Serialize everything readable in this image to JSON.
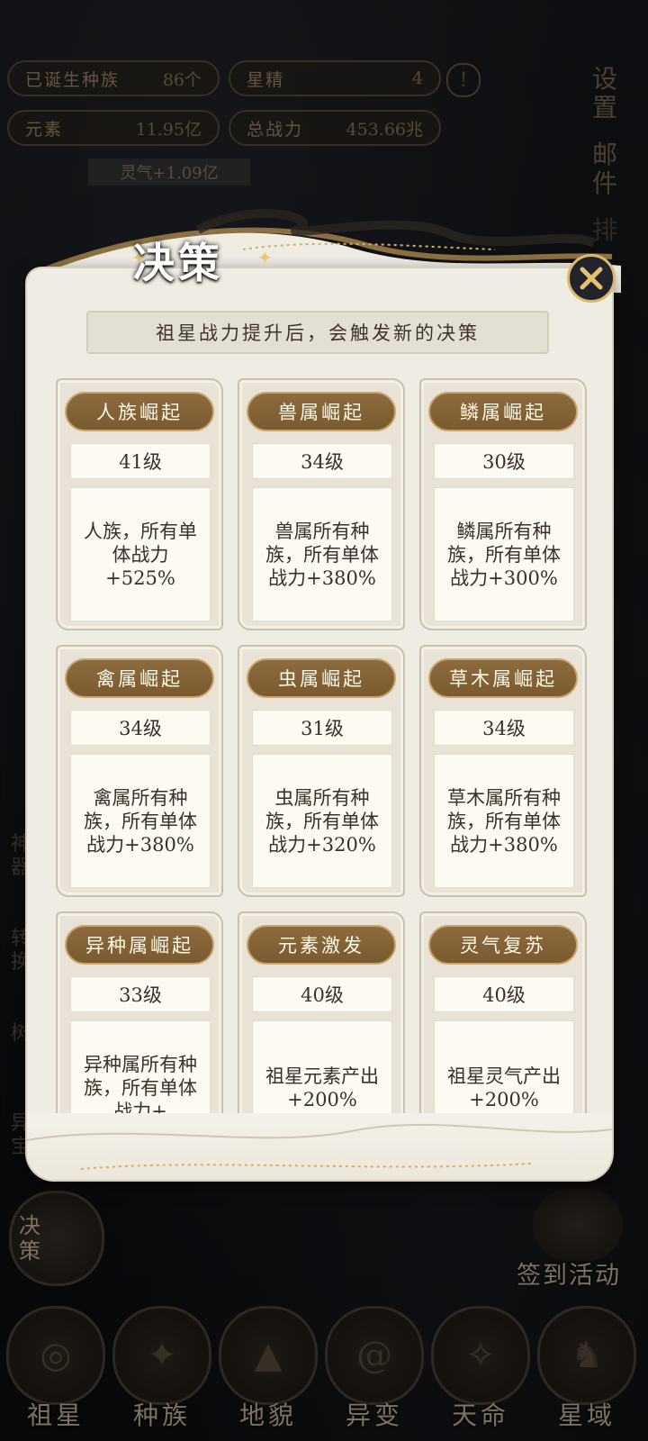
{
  "stats": {
    "races_label": "已诞生种族",
    "races_value": "86个",
    "essence_label": "星精",
    "essence_value": "4",
    "element_label": "元素",
    "element_value": "11.95亿",
    "power_label": "总战力",
    "power_value": "453.66兆",
    "aura_gain": "灵气+1.09亿"
  },
  "side_menu": {
    "settings": "设置",
    "mail": "邮件",
    "rank": "排"
  },
  "left_rail": {
    "r1": "神器",
    "r2": "转换",
    "r3": "树",
    "r4": "异宝"
  },
  "decision_button": "决策",
  "activity_button": "签到活动",
  "bottom_nav": [
    "祖星",
    "种族",
    "地貌",
    "异变",
    "天命",
    "星域"
  ],
  "modal": {
    "title": "决策",
    "hint": "祖星战力提升后，会触发新的决策",
    "cards": [
      {
        "name": "人族崛起",
        "level": "41级",
        "desc": "人族，所有单体战力+525%"
      },
      {
        "name": "兽属崛起",
        "level": "34级",
        "desc": "兽属所有种族，所有单体战力+380%"
      },
      {
        "name": "鳞属崛起",
        "level": "30级",
        "desc": "鳞属所有种族，所有单体战力+300%"
      },
      {
        "name": "禽属崛起",
        "level": "34级",
        "desc": "禽属所有种族，所有单体战力+380%"
      },
      {
        "name": "虫属崛起",
        "level": "31级",
        "desc": "虫属所有种族，所有单体战力+320%"
      },
      {
        "name": "草木属崛起",
        "level": "34级",
        "desc": "草木属所有种族，所有单体战力+380%"
      },
      {
        "name": "异种属崛起",
        "level": "33级",
        "desc": "异种属所有种族，所有单体战力+"
      },
      {
        "name": "元素激发",
        "level": "40级",
        "desc": "祖星元素产出+200%"
      },
      {
        "name": "灵气复苏",
        "level": "40级",
        "desc": "祖星灵气产出+200%"
      }
    ]
  },
  "colors": {
    "accent_brown": "#7a5a30",
    "gold": "#d9b96c",
    "paper": "#efece4"
  }
}
